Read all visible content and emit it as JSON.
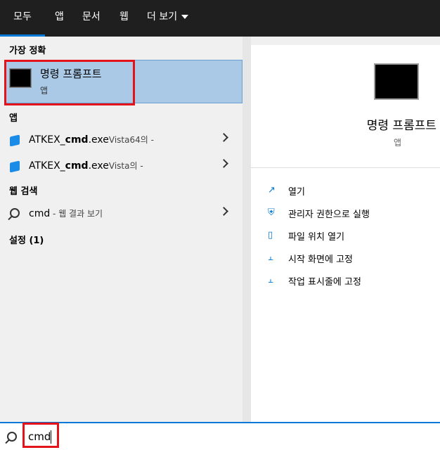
{
  "tabs": [
    {
      "label": "모두",
      "active": true
    },
    {
      "label": "앱"
    },
    {
      "label": "문서"
    },
    {
      "label": "웹"
    },
    {
      "label": "더 보기"
    }
  ],
  "best_match": {
    "section": "가장 정확",
    "title": "명령 프롬프트",
    "subtitle": "앱"
  },
  "apps": {
    "section": "앱",
    "items": [
      {
        "prefix": "ATKEX_",
        "bold": "cmd",
        "suffix": ".exe",
        "muted": "Vista64의 -"
      },
      {
        "prefix": "ATKEX_",
        "bold": "cmd",
        "suffix": ".exe",
        "muted": "Vista의 -"
      }
    ]
  },
  "web": {
    "section": "웹 검색",
    "query": "cmd",
    "muted": " - 웹 결과 보기"
  },
  "settings": {
    "section": "설정 (1)"
  },
  "preview": {
    "title": "명령 프롬프트",
    "subtitle": "앱",
    "actions": [
      {
        "label": "열기",
        "icon": "open-icon"
      },
      {
        "label": "관리자 권한으로 실행",
        "icon": "shield-icon"
      },
      {
        "label": "파일 위치 열기",
        "icon": "file-location-icon"
      },
      {
        "label": "시작 화면에 고정",
        "icon": "pin-icon"
      },
      {
        "label": "작업 표시줄에 고정",
        "icon": "pin-icon"
      }
    ]
  },
  "search": {
    "value": "cmd"
  },
  "colors": {
    "accent": "#0078d7",
    "highlight": "#a9c9e6",
    "annotation": "#e3121b"
  }
}
